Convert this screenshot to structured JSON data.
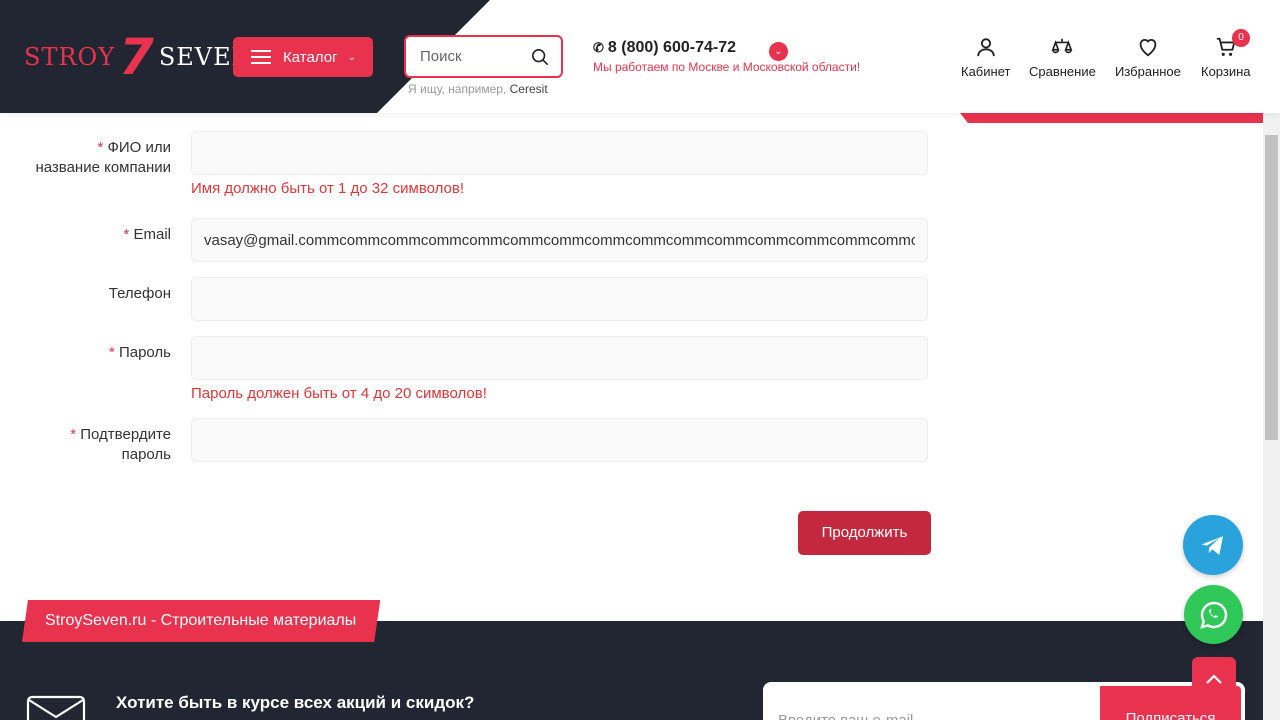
{
  "header": {
    "logo_left": "STROY",
    "logo_num": "7",
    "logo_right": "SEVEN",
    "catalog_label": "Каталог",
    "search_placeholder": "Поиск",
    "search_hint_prefix": "Я ищу, например,",
    "search_hint_example": "Ceresit",
    "phone": "8 (800) 600-74-72",
    "region": "Мы работаем по Москве и Московской области!",
    "nav": [
      {
        "label": "Кабинет",
        "icon": "user-icon"
      },
      {
        "label": "Сравнение",
        "icon": "compare-icon"
      },
      {
        "label": "Избранное",
        "icon": "heart-icon"
      },
      {
        "label": "Корзина",
        "icon": "cart-icon"
      }
    ],
    "cart_count": "0"
  },
  "form": {
    "name_label_req": "*",
    "name_label": "ФИО или название компании",
    "name_value": "",
    "name_error": "Имя должно быть от 1 до 32 символов!",
    "email_label_req": "*",
    "email_label": "Email",
    "email_value": "vasay@gmail.commcommcommcommcommcommcommcommcommcommcommcommcommcommcommcommcomm",
    "phone_label": "Телефон",
    "phone_value": "",
    "password_label_req": "*",
    "password_label": "Пароль",
    "password_value": "",
    "password_error": "Пароль должен быть от 4 до 20 символов!",
    "confirm_label_req": "*",
    "confirm_label": "Подтвердите пароль",
    "confirm_value": "",
    "continue_label": "Продолжить"
  },
  "footer": {
    "tag": "StroySeven.ru - Строительные материалы",
    "subscribe_text": "Хотите быть в курсе всех акций и скидок?",
    "subscribe_placeholder": "Введите ваш e-mail",
    "subscribe_button": "Подписаться"
  },
  "colors": {
    "accent": "#e8324e",
    "dark": "#222632",
    "error": "#e03636",
    "telegram": "#2aa3dc",
    "whatsapp": "#31c85a"
  }
}
